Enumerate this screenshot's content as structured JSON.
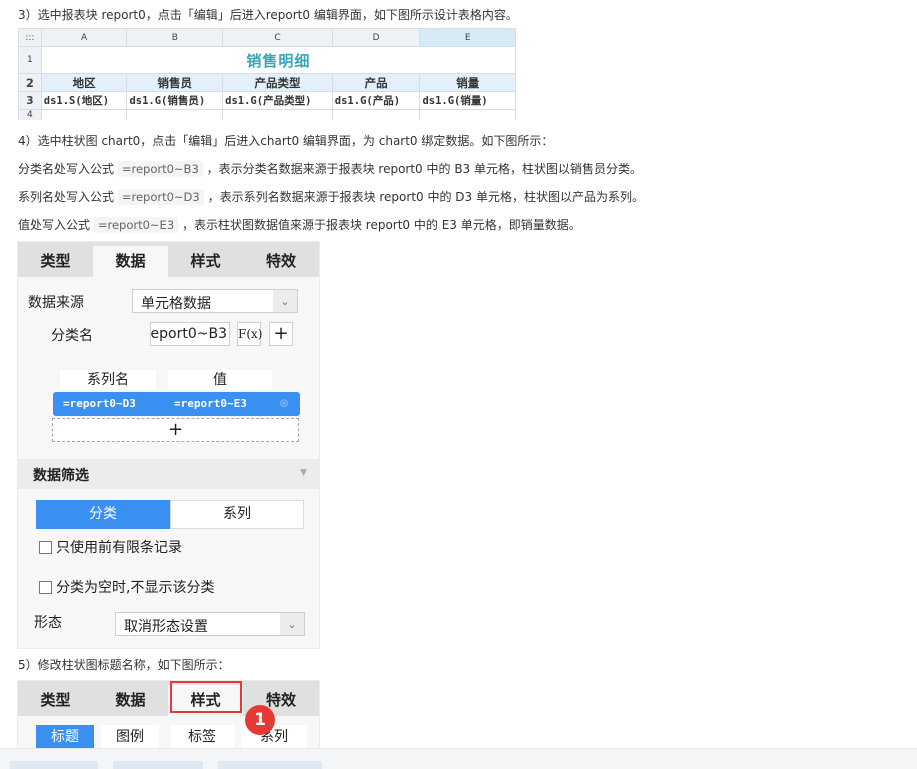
{
  "steps": {
    "step3": "3）选中报表块 report0，点击「编辑」后进入report0 编辑界面，如下图所示设计表格内容。",
    "step4": "4）选中柱状图 chart0，点击「编辑」后进入chart0 编辑界面，为 chart0 绑定数据。如下图所示：",
    "cat_pre": "分类名处写入公式",
    "cat_code": "=report0~B3",
    "cat_post": "，表示分类名数据来源于报表块 report0 中的 B3 单元格，柱状图以销售员分类。",
    "ser_pre": "系列名处写入公式",
    "ser_code": "=report0~D3",
    "ser_post": "，表示系列名数据来源于报表块 report0 中的 D3 单元格，柱状图以产品为系列。",
    "val_pre": "值处写入公式",
    "val_code": "=report0~E3",
    "val_post": "，表示柱状图数据值来源于报表块 report0 中的 E3 单元格，即销量数据。",
    "step5": "5）修改柱状图标题名称，如下图所示："
  },
  "sheet": {
    "corner": ":::",
    "col_headers": [
      "A",
      "B",
      "C",
      "D",
      "E"
    ],
    "row_numbers": [
      "1",
      "2",
      "3",
      "4"
    ],
    "title": "销售明细",
    "headers": [
      "地区",
      "销售员",
      "产品类型",
      "产品",
      "销量"
    ],
    "bindings": [
      "ds1.S(地区)",
      "ds1.G(销售员)",
      "ds1.G(产品类型)",
      "ds1.G(产品)",
      "ds1.G(销量)"
    ]
  },
  "data_panel": {
    "tabs": [
      "类型",
      "数据",
      "样式",
      "特效"
    ],
    "active_tab": "数据",
    "source_label": "数据来源",
    "source_value": "单元格数据",
    "category_label": "分类名",
    "category_value": "report0~B3",
    "fx_label": "F(x)",
    "plus": "+",
    "series_col": "系列名",
    "value_col": "值",
    "series_formula": "=report0~D3",
    "value_formula": "=report0~E3",
    "filter_title": "数据筛选",
    "seg_category": "分类",
    "seg_series": "系列",
    "check_top": "只使用前有限条记录",
    "check_empty": "分类为空时,不显示该分类",
    "form_label": "形态",
    "form_value": "取消形态设置"
  },
  "style_panel": {
    "tabs": [
      "类型",
      "数据",
      "样式",
      "特效"
    ],
    "sub_tabs": [
      "标题",
      "图例",
      "标签",
      "系列"
    ],
    "badge": "1"
  },
  "colors": {
    "accent": "#3a90f0",
    "highlight": "#e53935",
    "sheet_title": "#35a7b6"
  }
}
